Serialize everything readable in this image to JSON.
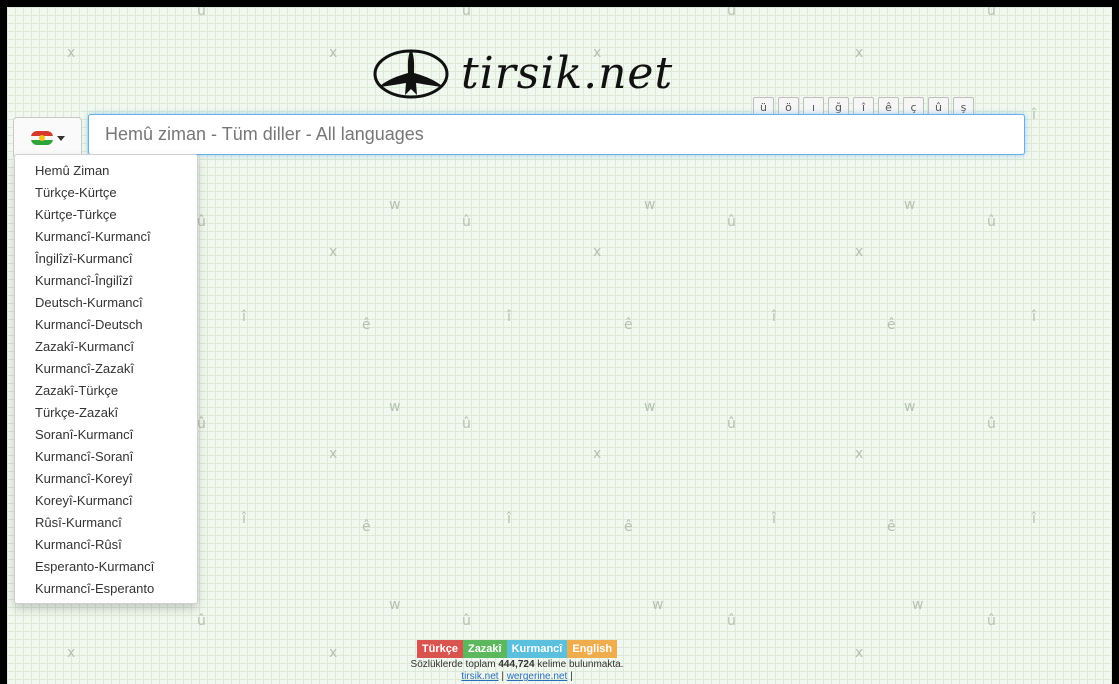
{
  "site": {
    "name": "tirsik.net"
  },
  "special_chars": [
    "ü",
    "ö",
    "ı",
    "ğ",
    "î",
    "ê",
    "ç",
    "û",
    "ş"
  ],
  "search": {
    "placeholder": "Hemû ziman - Tüm diller - All languages",
    "value": ""
  },
  "language_menu": {
    "selected_flag": "kurdistan-flag-icon",
    "items": [
      "Hemû Ziman",
      "Türkçe-Kürtçe",
      "Kürtçe-Türkçe",
      "Kurmancî-Kurmancî",
      "Îngilîzî-Kurmancî",
      "Kurmancî-Îngilîzî",
      "Deutsch-Kurmancî",
      "Kurmancî-Deutsch",
      "Zazakî-Kurmancî",
      "Kurmancî-Zazakî",
      "Zazakî-Türkçe",
      "Türkçe-Zazakî",
      "Soranî-Kurmancî",
      "Kurmancî-Soranî",
      "Kurmancî-Koreyî",
      "Koreyî-Kurmancî",
      "Rûsî-Kurmancî",
      "Kurmancî-Rûsî",
      "Esperanto-Kurmancî",
      "Kurmancî-Esperanto"
    ]
  },
  "footer": {
    "languages": [
      {
        "label": "Türkçe",
        "color": "#d9534f"
      },
      {
        "label": "Zazakî",
        "color": "#5cb85c"
      },
      {
        "label": "Kurmancî",
        "color": "#5bc0de"
      },
      {
        "label": "English",
        "color": "#f0ad4e"
      }
    ],
    "stat_prefix": "Sözlüklerde toplam",
    "word_count": "444,724",
    "stat_suffix": "kelime bulunmakta.",
    "links": [
      "tirsik.net",
      "wergerine.net"
    ]
  },
  "background_glyphs": [
    "û",
    "ê",
    "î",
    "x",
    "w"
  ]
}
